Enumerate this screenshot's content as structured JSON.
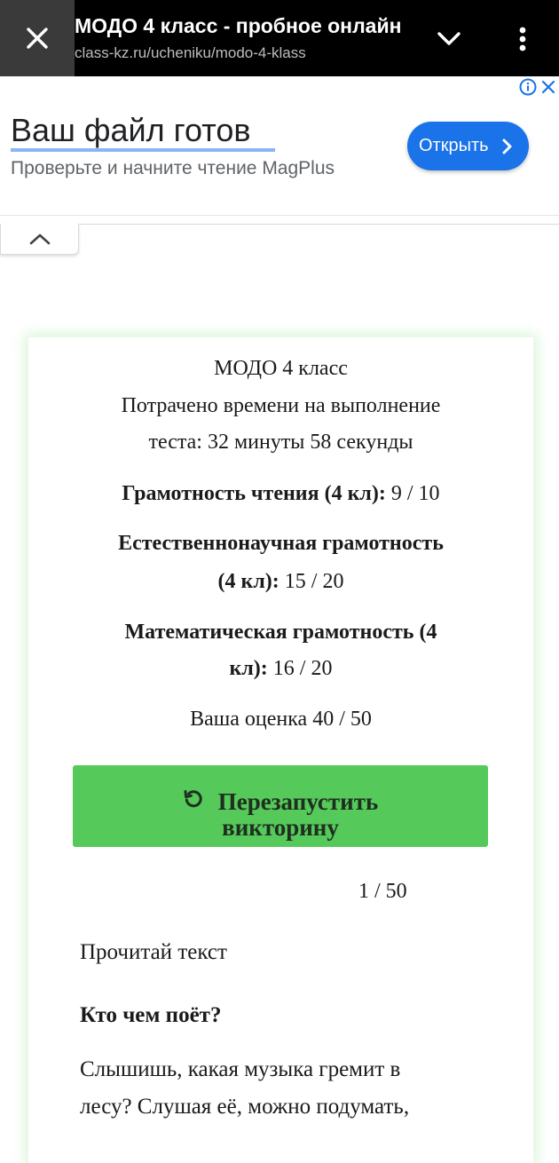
{
  "browser": {
    "title": "МОДО 4 класс - пробное онлайн",
    "url": "class-kz.ru/ucheniku/modo-4-klass"
  },
  "ad": {
    "headline": "Ваш файл готов",
    "subtext": "Проверьте и начните чтение MagPlus",
    "button_label": "Открыть",
    "button_color": "#1a73e8"
  },
  "results": {
    "quiz_name": "МОДО 4 класс",
    "time_line1": "Потрачено времени на выполнение",
    "time_line2": "теста: 32 минуты 58 секунды",
    "categories": [
      {
        "line1": "Грамотность чтения (4 кл):",
        "line1_score": " 9 / 10"
      },
      {
        "line1": "Естественнонаучная грамотность",
        "line2": "(4 кл):",
        "score": " 15 / 20"
      },
      {
        "line1": "Математическая грамотность (4",
        "line2": "кл):",
        "score": " 16 / 20"
      }
    ],
    "total": "Ваша оценка 40 / 50",
    "restart_line1": "Перезапустить",
    "restart_line2": "викторину",
    "accent_color": "#55c95a"
  },
  "question": {
    "counter": "1 / 50",
    "intro": "Прочитай текст",
    "title": "Кто чем поёт?",
    "text_line1": "Слышишь, какая музыка гремит в",
    "text_line2": "лесу? Слушая её, можно подумать,"
  },
  "icons": [
    "close-icon",
    "chevron-down-icon",
    "more-vert-icon",
    "info-icon",
    "ad-close-icon",
    "chevron-right-icon",
    "chevron-up-icon",
    "restart-icon"
  ]
}
